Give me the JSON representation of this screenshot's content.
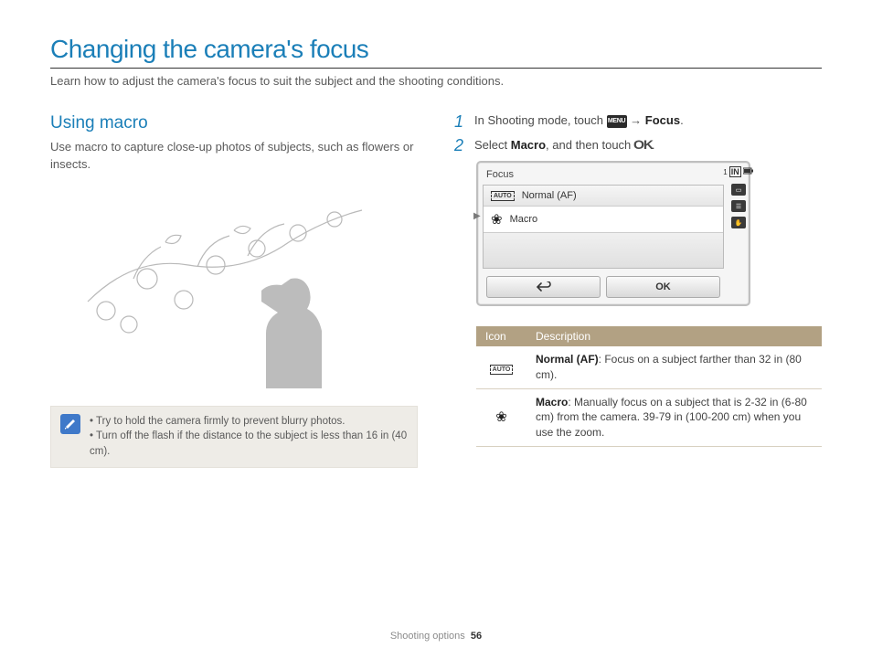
{
  "page_title": "Changing the camera's focus",
  "page_intro": "Learn how to adjust the camera's focus to suit the subject and the shooting conditions.",
  "section": {
    "title": "Using macro",
    "intro": "Use macro to capture close-up photos of subjects, such as flowers or insects."
  },
  "notes": {
    "0": "Try to hold the camera firmly to prevent blurry photos.",
    "1": "Turn off the flash if the distance to the subject is less than 16 in (40 cm)."
  },
  "steps": {
    "0": {
      "num": "1",
      "pre": "In Shooting mode, touch ",
      "menu": "MENU",
      "arrow": " → ",
      "target": "Focus",
      "post": "."
    },
    "1": {
      "num": "2",
      "pre": "Select ",
      "target": "Macro",
      "mid": ", and then touch ",
      "ok": "OK",
      "post": "."
    }
  },
  "screen": {
    "title": "Focus",
    "opt_normal": "Normal (AF)",
    "opt_macro": "Macro",
    "btn_ok": "OK",
    "side_count": "1"
  },
  "table": {
    "head_icon": "Icon",
    "head_desc": "Description",
    "normal_bold": "Normal (AF)",
    "normal_rest": ": Focus on a subject farther than 32 in (80 cm).",
    "macro_bold": "Macro",
    "macro_rest": ": Manually focus on a subject that is 2-32 in (6-80 cm) from the camera. 39-79 in (100-200 cm) when you use the zoom."
  },
  "footer": {
    "section": "Shooting options",
    "page": "56"
  }
}
